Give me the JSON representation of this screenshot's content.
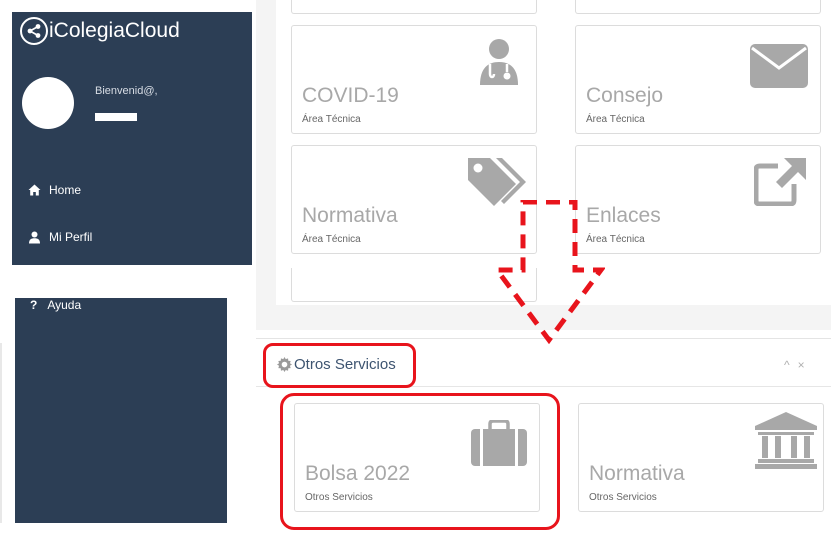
{
  "app": {
    "brand": "iColegiaCloud",
    "welcome": "Bienvenid@,"
  },
  "sidebar": {
    "items": [
      {
        "label": "Home",
        "icon": "home-icon"
      },
      {
        "label": "Mi Perfil",
        "icon": "user-icon"
      },
      {
        "label": "Ayuda",
        "icon": "question-icon"
      }
    ]
  },
  "cards": [
    {
      "title": "COVID-19",
      "subtitle": "Área Técnica",
      "icon": "doctor-icon"
    },
    {
      "title": "Consejo",
      "subtitle": "Área Técnica",
      "icon": "envelope-icon"
    },
    {
      "title": "Normativa",
      "subtitle": "Área Técnica",
      "icon": "tags-icon"
    },
    {
      "title": "Enlaces",
      "subtitle": "Área Técnica",
      "icon": "external-link-icon"
    }
  ],
  "otros": {
    "title": "Otros Servicios",
    "cards": [
      {
        "title": "Bolsa 2022",
        "subtitle": "Otros Servicios",
        "icon": "briefcase-icon"
      },
      {
        "title": "Normativa",
        "subtitle": "Otros Servicios",
        "icon": "bank-icon"
      }
    ]
  },
  "colors": {
    "sidebar": "#2c3e55",
    "highlight": "#e8141c",
    "icon_gray": "#a8a8a8"
  }
}
